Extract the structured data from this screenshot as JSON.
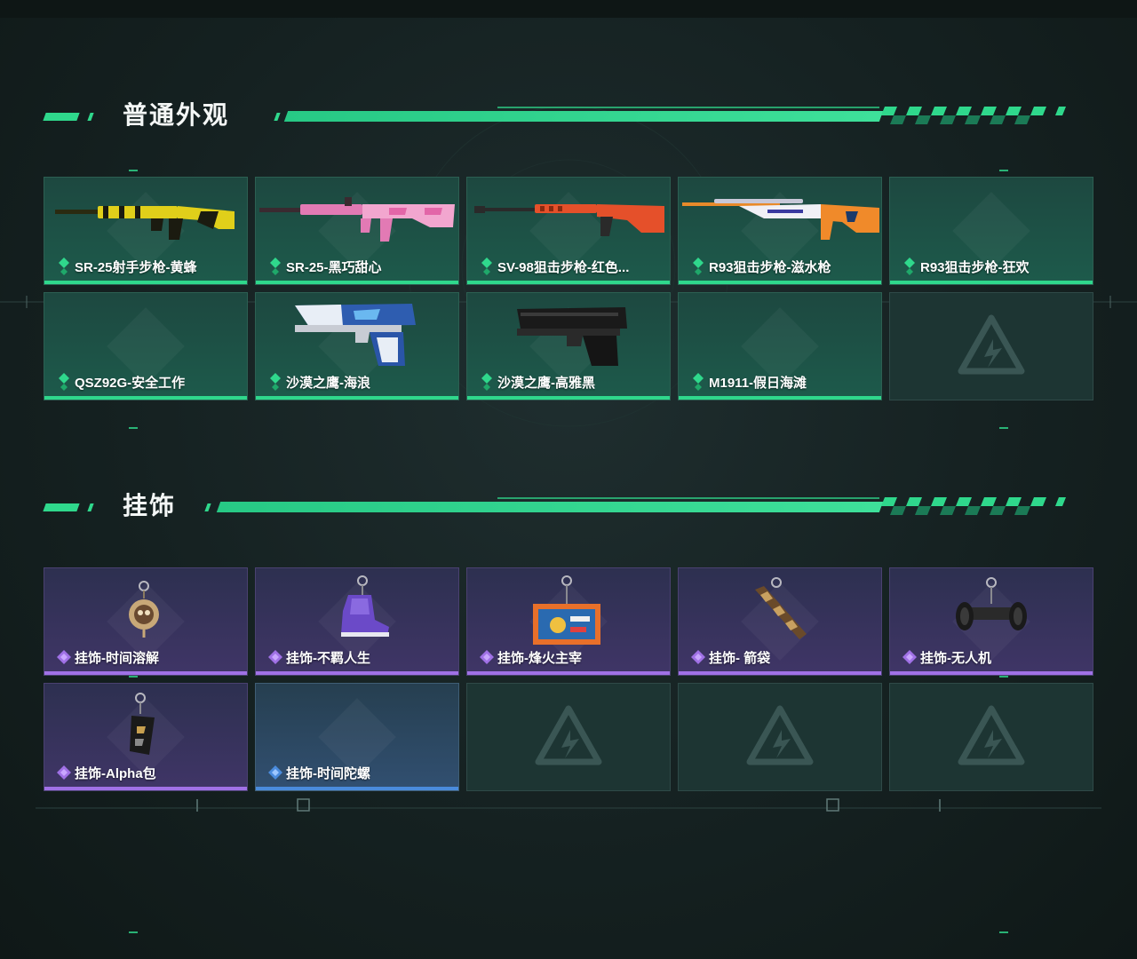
{
  "colors": {
    "accent": "#2fd88c",
    "green_card": "#1d5a4b",
    "purple_card": "#3f3566",
    "blue_card": "#314f70",
    "empty_card": "#1d3533"
  },
  "sections": [
    {
      "title": "普通外观",
      "items": [
        {
          "name": "SR-25射手步枪-黄蜂",
          "rarity": "green",
          "art": "rifle-yellow"
        },
        {
          "name": "SR-25-黑巧甜心",
          "rarity": "green",
          "art": "rifle-pink"
        },
        {
          "name": "SV-98狙击步枪-红色...",
          "rarity": "green",
          "art": "sniper-red"
        },
        {
          "name": "R93狙击步枪-滋水枪",
          "rarity": "green",
          "art": "sniper-orange"
        },
        {
          "name": "R93狙击步枪-狂欢",
          "rarity": "green",
          "art": "none"
        },
        {
          "name": "QSZ92G-安全工作",
          "rarity": "green",
          "art": "none"
        },
        {
          "name": "沙漠之鹰-海浪",
          "rarity": "green",
          "art": "pistol-blue"
        },
        {
          "name": "沙漠之鹰-高雅黑",
          "rarity": "green",
          "art": "pistol-black"
        },
        {
          "name": "M1911-假日海滩",
          "rarity": "green",
          "art": "none"
        },
        {
          "name": "",
          "rarity": "empty",
          "art": "logo"
        }
      ]
    },
    {
      "title": "挂饰",
      "items": [
        {
          "name": "挂饰-时间溶解",
          "rarity": "purple",
          "art": "charm-skull"
        },
        {
          "name": "挂饰-不羁人生",
          "rarity": "purple",
          "art": "charm-shoe"
        },
        {
          "name": "挂饰-烽火主宰",
          "rarity": "purple",
          "art": "charm-box"
        },
        {
          "name": "挂饰- 箭袋",
          "rarity": "purple",
          "art": "charm-quiver"
        },
        {
          "name": "挂饰-无人机",
          "rarity": "purple",
          "art": "charm-drone"
        },
        {
          "name": "挂饰-Alpha包",
          "rarity": "purple",
          "art": "charm-bag"
        },
        {
          "name": "挂饰-时间陀螺",
          "rarity": "blue",
          "art": "none"
        },
        {
          "name": "",
          "rarity": "empty",
          "art": "logo"
        },
        {
          "name": "",
          "rarity": "empty",
          "art": "logo"
        },
        {
          "name": "",
          "rarity": "empty",
          "art": "logo"
        }
      ]
    }
  ]
}
